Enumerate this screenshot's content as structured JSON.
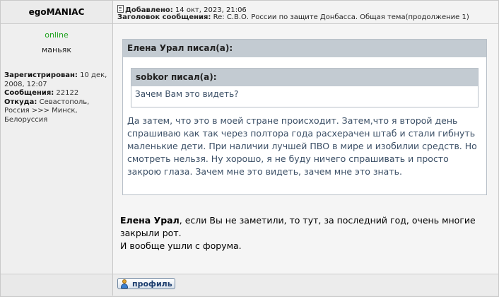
{
  "author": {
    "username": "egoMANIAC",
    "status": "online",
    "rank": "маньяк",
    "registered_label": "Зарегистрирован:",
    "registered_value": "10 дек, 2008, 12:07",
    "messages_label": "Сообщения:",
    "messages_value": "22122",
    "from_label": "Откуда:",
    "from_value": "Севастополь, Россия >>> Минск, Белоруссия"
  },
  "post": {
    "added_label": "Добавлено:",
    "added_value": "14 окт, 2023, 21:06",
    "subject_label": "Заголовок сообщения:",
    "subject_value": "Re: С.В.О. России по защите Донбасса. Общая тема(продолжение 1)",
    "outer_quote": {
      "title": "Елена Урал писал(а):",
      "text": "Да затем, что это в моей стране происходит. Затем,что я второй день спрашиваю как так через полтора года расхерачен штаб и стали гибнуть маленькие дети. При наличии лучшей ПВО в мире и изобилии средств. Но смотреть нельзя. Ну хорошо, я не буду ничего спрашивать и просто закрою глаза. Зачем мне это видеть, зачем мне это знать."
    },
    "inner_quote": {
      "title": "sobkor писал(а):",
      "text": "Зачем Вам это видеть?"
    },
    "reply_name": "Елена Урал",
    "reply_line1": ", если Вы не заметили, то тут, за последний год, очень многие закрыли рот.",
    "reply_line2": "И вообще ушли с форума."
  },
  "actions": {
    "profile_label": "профиль"
  },
  "icons": {
    "post_icon": "document-icon",
    "profile_icon": "person-icon"
  }
}
